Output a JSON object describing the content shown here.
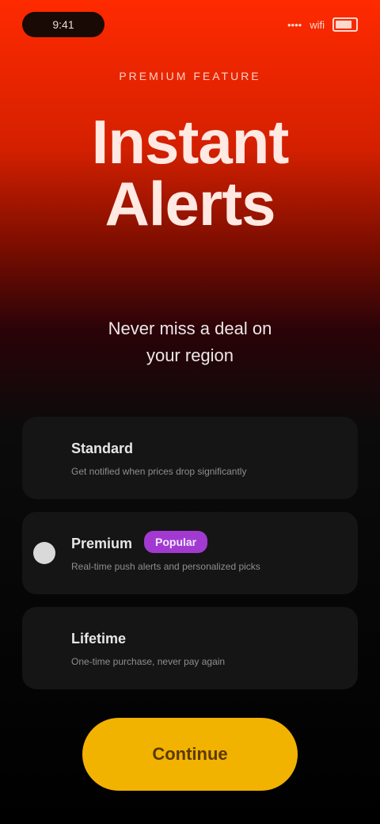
{
  "status": {
    "time": "9:41",
    "signal": "••••",
    "wifi": "wifi"
  },
  "hero": {
    "eyebrow": "PREMIUM FEATURE",
    "title_line1": "Instant",
    "title_line2": "Alerts",
    "subtitle_line1": "Never miss a deal on",
    "subtitle_line2": "your region"
  },
  "options": [
    {
      "title": "Standard",
      "subtitle": "Get notified when prices drop significantly",
      "selected": false
    },
    {
      "title": "Premium",
      "badge": "Popular",
      "subtitle": "Real-time push alerts and personalized picks",
      "selected": true
    },
    {
      "title": "Lifetime",
      "subtitle": "One-time purchase, never pay again",
      "selected": false
    }
  ],
  "cta": {
    "label": "Continue"
  },
  "colors": {
    "accent": "#f2b200",
    "badge": "#a23ad1",
    "hero_top": "#ff2a00"
  }
}
